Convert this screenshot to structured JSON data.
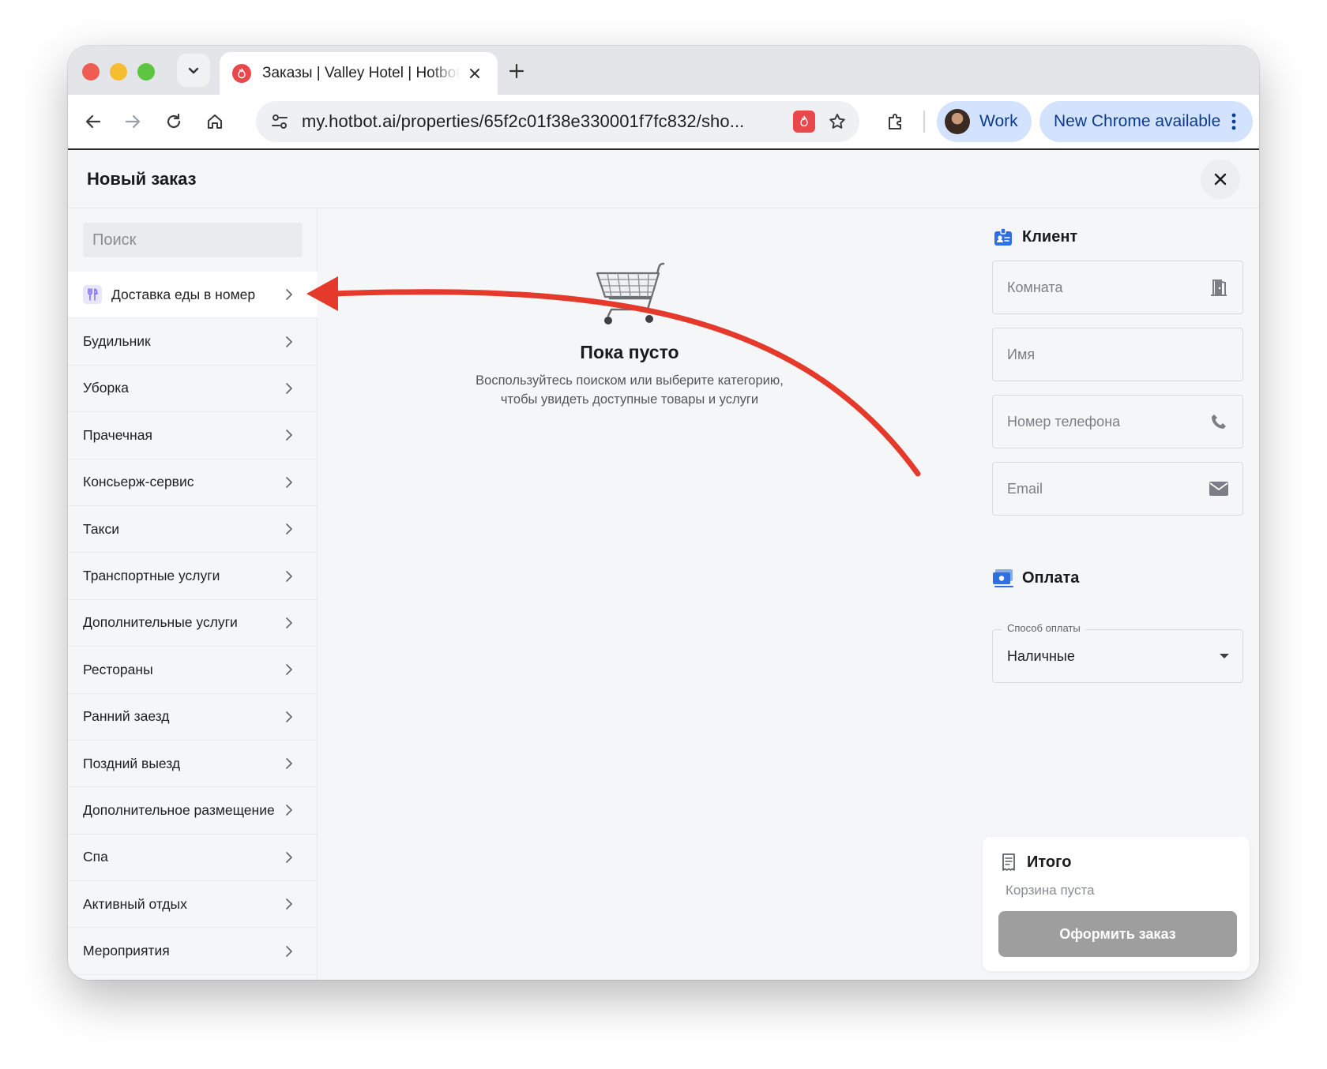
{
  "browser": {
    "tab_title": "Заказы | Valley Hotel | Hotbot",
    "url": "my.hotbot.ai/properties/65f2c01f38e330001f7fc832/sho...",
    "profile_name": "Work",
    "update_label": "New Chrome available"
  },
  "dialog": {
    "title": "Новый заказ"
  },
  "sidebar": {
    "search_placeholder": "Поиск",
    "categories": [
      {
        "label": "Доставка еды в номер",
        "icon": "fork-knife-icon",
        "active": true
      },
      {
        "label": "Будильник"
      },
      {
        "label": "Уборка"
      },
      {
        "label": "Прачечная"
      },
      {
        "label": "Консьерж-сервис"
      },
      {
        "label": "Такси"
      },
      {
        "label": "Транспортные услуги"
      },
      {
        "label": "Дополнительные услуги"
      },
      {
        "label": "Рестораны"
      },
      {
        "label": "Ранний заезд"
      },
      {
        "label": "Поздний выезд"
      },
      {
        "label": "Дополнительное размещение"
      },
      {
        "label": "Спа"
      },
      {
        "label": "Активный отдых"
      },
      {
        "label": "Мероприятия"
      }
    ]
  },
  "empty_state": {
    "icon": "shopping-cart-icon",
    "title": "Пока пусто",
    "desc_line1": "Воспользуйтесь поиском или выберите категорию,",
    "desc_line2": "чтобы увидеть доступные товары и услуги"
  },
  "client": {
    "heading": "Клиент",
    "room_placeholder": "Комната",
    "name_placeholder": "Имя",
    "phone_placeholder": "Номер телефона",
    "email_placeholder": "Email"
  },
  "payment": {
    "heading": "Оплата",
    "method_label": "Способ оплаты",
    "method_value": "Наличные"
  },
  "summary": {
    "heading": "Итого",
    "empty_text": "Корзина пуста",
    "checkout_label": "Оформить заказ"
  },
  "colors": {
    "accent_blue": "#2f6fe4",
    "annotation_red": "#e5392b",
    "disabled_button": "#9e9e9e"
  }
}
